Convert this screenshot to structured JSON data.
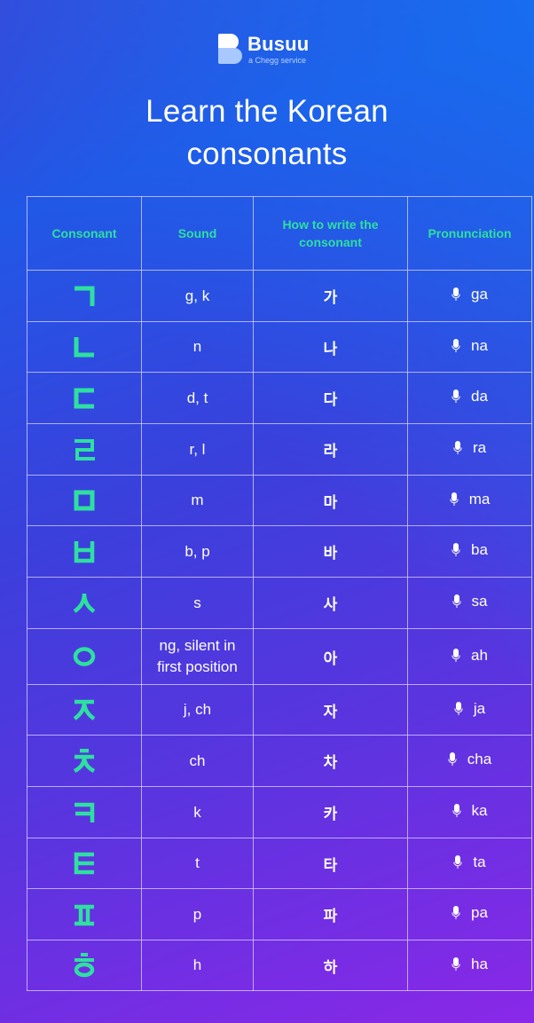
{
  "brand": {
    "name": "Busuu",
    "tagline": "a Chegg service"
  },
  "title": {
    "line1": "Learn the Korean",
    "line2": "consonants"
  },
  "colors": {
    "accent_green": "#2ee0a0",
    "text": "#ffffff",
    "grid_line": "#dcd2ff",
    "bg_top": "#1a6ef0",
    "bg_bottom": "#8a28e8"
  },
  "table": {
    "headers": [
      "Consonant",
      "Sound",
      "How to write the consonant",
      "Pronunciation"
    ],
    "pronunciation_icon": "microphone-icon",
    "rows": [
      {
        "consonant": "ㄱ",
        "sound": "g, k",
        "syllable": "가",
        "pronunciation": "ga"
      },
      {
        "consonant": "ㄴ",
        "sound": "n",
        "syllable": "나",
        "pronunciation": "na"
      },
      {
        "consonant": "ㄷ",
        "sound": "d, t",
        "syllable": "다",
        "pronunciation": "da"
      },
      {
        "consonant": "ㄹ",
        "sound": "r, l",
        "syllable": "라",
        "pronunciation": "ra"
      },
      {
        "consonant": "ㅁ",
        "sound": "m",
        "syllable": "마",
        "pronunciation": "ma"
      },
      {
        "consonant": "ㅂ",
        "sound": "b, p",
        "syllable": "바",
        "pronunciation": "ba"
      },
      {
        "consonant": "ㅅ",
        "sound": "s",
        "syllable": "사",
        "pronunciation": "sa"
      },
      {
        "consonant": "ㅇ",
        "sound": "ng, silent in first position",
        "syllable": "아",
        "pronunciation": "ah"
      },
      {
        "consonant": "ㅈ",
        "sound": "j, ch",
        "syllable": "자",
        "pronunciation": "ja"
      },
      {
        "consonant": "ㅊ",
        "sound": "ch",
        "syllable": "차",
        "pronunciation": "cha"
      },
      {
        "consonant": "ㅋ",
        "sound": "k",
        "syllable": "카",
        "pronunciation": "ka"
      },
      {
        "consonant": "ㅌ",
        "sound": "t",
        "syllable": "타",
        "pronunciation": "ta"
      },
      {
        "consonant": "ㅍ",
        "sound": "p",
        "syllable": "파",
        "pronunciation": "pa"
      },
      {
        "consonant": "ㅎ",
        "sound": "h",
        "syllable": "하",
        "pronunciation": "ha"
      }
    ]
  }
}
